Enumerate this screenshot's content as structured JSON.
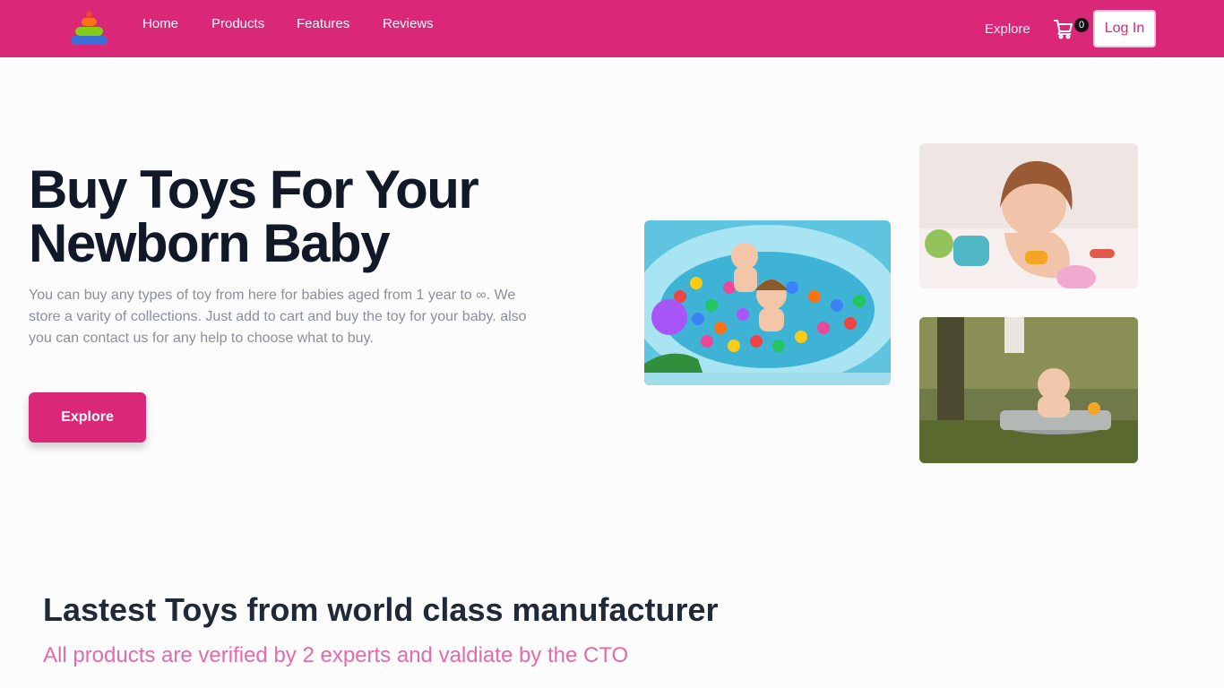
{
  "nav": {
    "links": [
      "Home",
      "Products",
      "Features",
      "Reviews"
    ],
    "explore": "Explore",
    "cart_count": "0",
    "login": "Log In"
  },
  "hero": {
    "title": "Buy Toys For Your Newborn Baby",
    "description": "You can buy any types of toy from here for babies aged from 1 year to ∞. We store a varity of collections. Just add to cart and buy the toy for your baby. also you can contact us for any help to choose what to buy.",
    "button": "Explore"
  },
  "section": {
    "title": "Lastest Toys from world class manufacturer",
    "subtitle": "All products are verified by 2 experts and valdiate by the CTO"
  },
  "icons": {
    "logo": "stacking-rings-toy-logo",
    "cart": "shopping-cart-icon"
  },
  "colors": {
    "brand": "#db2777",
    "subtitle": "#e56aa8",
    "heading": "#111827"
  }
}
